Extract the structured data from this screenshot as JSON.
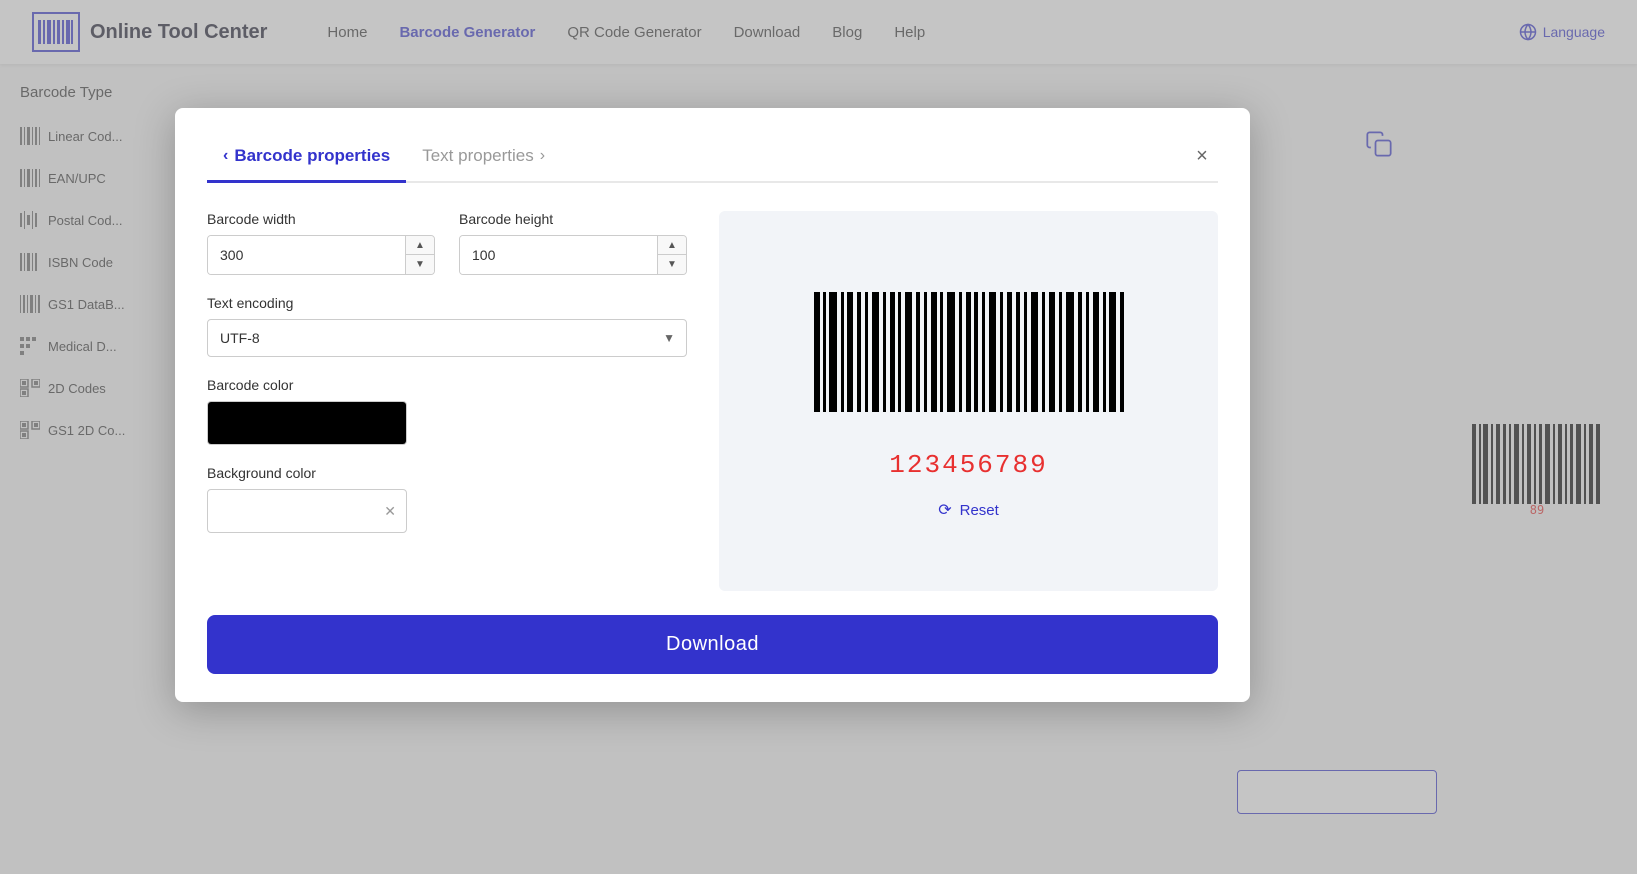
{
  "navbar": {
    "logo_text": "Online Tool Center",
    "links": [
      {
        "label": "Home",
        "active": false
      },
      {
        "label": "Barcode Generator",
        "active": true
      },
      {
        "label": "QR Code Generator",
        "active": false
      },
      {
        "label": "Download",
        "active": false
      },
      {
        "label": "Blog",
        "active": false
      },
      {
        "label": "Help",
        "active": false
      }
    ],
    "language_label": "Language"
  },
  "sidebar": {
    "title": "Barcode Type",
    "items": [
      {
        "label": "Linear Cod..."
      },
      {
        "label": "EAN/UPC"
      },
      {
        "label": "Postal Cod..."
      },
      {
        "label": "ISBN Code"
      },
      {
        "label": "GS1 DataB..."
      },
      {
        "label": "Medical D..."
      },
      {
        "label": "2D Codes"
      },
      {
        "label": "GS1 2D Co..."
      }
    ]
  },
  "modal": {
    "tab_barcode": "Barcode properties",
    "tab_text": "Text properties",
    "close_label": "×",
    "barcode_width_label": "Barcode width",
    "barcode_width_value": "300",
    "barcode_height_label": "Barcode height",
    "barcode_height_value": "100",
    "text_encoding_label": "Text encoding",
    "text_encoding_value": "UTF-8",
    "barcode_color_label": "Barcode color",
    "background_color_label": "Background color",
    "barcode_number": "123456789",
    "reset_label": "Reset",
    "download_label": "Download"
  }
}
